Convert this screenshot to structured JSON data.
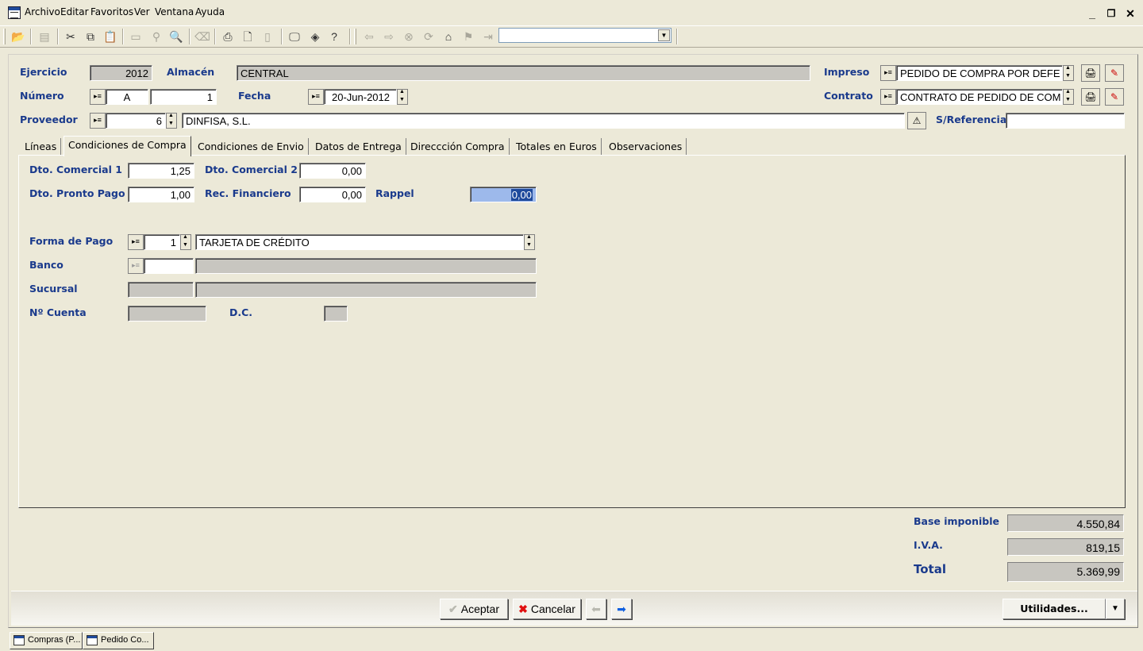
{
  "menu": [
    "Archivo",
    "Editar",
    "Favoritos",
    "Ver",
    "Ventana",
    "Ayuda"
  ],
  "header": {
    "ejercicio_label": "Ejercicio",
    "ejercicio_value": "2012",
    "almacen_label": "Almacén",
    "almacen_value": "CENTRAL",
    "impreso_label": "Impreso",
    "impreso_value": "PEDIDO DE COMPRA POR DEFE",
    "numero_label": "Número",
    "numero_serie": "A",
    "numero_value": "1",
    "fecha_label": "Fecha",
    "fecha_value": "20-Jun-2012",
    "contrato_label": "Contrato",
    "contrato_value": "CONTRATO DE PEDIDO DE COM",
    "proveedor_label": "Proveedor",
    "proveedor_code": "6",
    "proveedor_name": "DINFISA, S.L.",
    "sreferencia_label": "S/Referencia",
    "sreferencia_value": ""
  },
  "tabs": [
    {
      "label": "Líneas",
      "active": false
    },
    {
      "label": "Condiciones de Compra",
      "active": true
    },
    {
      "label": "Condiciones de Envio",
      "active": false
    },
    {
      "label": "Datos de Entrega",
      "active": false
    },
    {
      "label": "Direccción Compra",
      "active": false
    },
    {
      "label": "Totales en Euros",
      "active": false
    },
    {
      "label": "Observaciones",
      "active": false
    }
  ],
  "conditions": {
    "dto_comercial_1_label": "Dto. Comercial 1",
    "dto_comercial_1_value": "1,25",
    "dto_comercial_2_label": "Dto. Comercial 2",
    "dto_comercial_2_value": "0,00",
    "dto_pronto_pago_label": "Dto. Pronto Pago",
    "dto_pronto_pago_value": "1,00",
    "rec_financiero_label": "Rec. Financiero",
    "rec_financiero_value": "0,00",
    "rappel_label": "Rappel",
    "rappel_value": "0,00",
    "forma_pago_label": "Forma de Pago",
    "forma_pago_code": "1",
    "forma_pago_desc": "TARJETA DE CRÉDITO",
    "banco_label": "Banco",
    "banco_code": "",
    "banco_desc": "",
    "sucursal_label": "Sucursal",
    "sucursal_code": "",
    "sucursal_desc": "",
    "cuenta_label": "Nº Cuenta",
    "cuenta_value": "",
    "dc_label": "D.C.",
    "dc_value": ""
  },
  "totals": {
    "base_label": "Base imponible",
    "base_value": "4.550,84",
    "iva_label": "I.V.A.",
    "iva_value": "819,15",
    "total_label": "Total",
    "total_value": "5.369,99"
  },
  "buttons": {
    "aceptar": "Aceptar",
    "cancelar": "Cancelar",
    "utilidades": "Utilidades..."
  },
  "taskbar": [
    "Compras (P...",
    "Pedido Co..."
  ],
  "colors": {
    "label_blue": "#1a3a8c",
    "readonly_gray": "#c8c6c0",
    "window_bg": "#ece9d8",
    "selection": "#9db9eb"
  }
}
